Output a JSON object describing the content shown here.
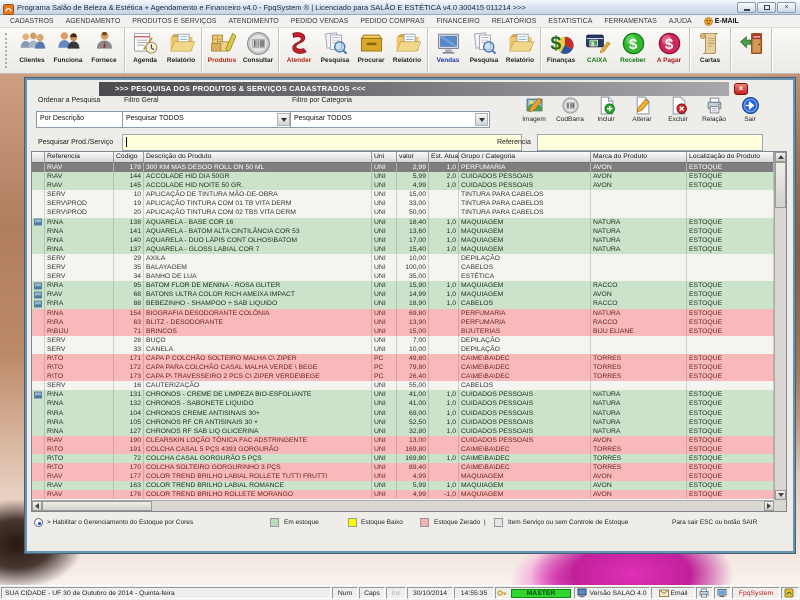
{
  "window": {
    "title": "Programa Salão de Beleza & Estética + Agendamento e Financeiro v4.0 - FpqSystem ® | Licenciado para  SALÃO E ESTÉTICA v4.0 300415 011214 >>>"
  },
  "menu": {
    "items": [
      {
        "label": "CADASTROS"
      },
      {
        "label": "AGENDAMENTO"
      },
      {
        "label": "PRODUTOS E SERVIÇOS"
      },
      {
        "label": "ATENDIMENTO"
      },
      {
        "label": "PEDIDO VENDAS"
      },
      {
        "label": "PEDIDO COMPRAS"
      },
      {
        "label": "FINANCEIRO"
      },
      {
        "label": "RELATÓRIOS"
      },
      {
        "label": "ESTATISTICA"
      },
      {
        "label": "FERRAMENTAS"
      },
      {
        "label": "AJUDA"
      },
      {
        "label": "E-MAIL",
        "icon": "email-menu-icon",
        "bold": true
      }
    ]
  },
  "toolbar": {
    "groups": [
      {
        "items": [
          {
            "label": "Clientes",
            "icon": "clients-icon"
          },
          {
            "label": "Funciona",
            "icon": "staff-icon"
          },
          {
            "label": "Fornece",
            "icon": "supplier-icon"
          }
        ]
      },
      {
        "items": [
          {
            "label": "Agenda",
            "icon": "agenda-icon"
          },
          {
            "label": "Relatório",
            "icon": "report-icon"
          }
        ]
      },
      {
        "items": [
          {
            "label": "Produtos",
            "icon": "products-icon",
            "color": "#b02810"
          },
          {
            "label": "Consultar",
            "icon": "barcode-icon"
          }
        ]
      },
      {
        "items": [
          {
            "label": "Atender",
            "icon": "attend-icon",
            "color": "#b02810"
          },
          {
            "label": "Pesquisa",
            "icon": "search-docs-icon"
          },
          {
            "label": "Procurar",
            "icon": "drawer-icon"
          },
          {
            "label": "Relatório",
            "icon": "report-icon"
          }
        ]
      },
      {
        "items": [
          {
            "label": "Vendas",
            "icon": "sales-icon",
            "color": "#1838a8"
          },
          {
            "label": "Pesquisa",
            "icon": "search-docs-icon"
          },
          {
            "label": "Relatório",
            "icon": "report-icon"
          }
        ]
      },
      {
        "items": [
          {
            "label": "Finanças",
            "icon": "finance-icon"
          },
          {
            "label": "CAIXA",
            "icon": "cash-icon",
            "color": "#187818"
          },
          {
            "label": "Receber",
            "icon": "receive-icon",
            "color": "#187818"
          },
          {
            "label": "A Pagar",
            "icon": "pay-icon",
            "color": "#a81818"
          }
        ]
      },
      {
        "items": [
          {
            "label": "Cartas",
            "icon": "letters-icon"
          }
        ]
      },
      {
        "items": [
          {
            "label": "",
            "icon": "exit-icon"
          }
        ]
      }
    ]
  },
  "panel": {
    "title": ">>>  PESQUISA DOS PRODUTOS & SERVIÇOS CADASTRADOS  <<<"
  },
  "filters": {
    "order": {
      "label": "Ordenar a Pesquisa",
      "value": "Por Descrição"
    },
    "general": {
      "label": "Filtro Geral",
      "value": "Pesquisar TODOS"
    },
    "category": {
      "label": "Filtro por Categoria",
      "value": "Pesquisar TODOS"
    },
    "search": {
      "label": "Pesquisar Prod./Serviço",
      "value": ""
    },
    "reference": {
      "label": "Referencia",
      "value": ""
    }
  },
  "actions": {
    "buttons": [
      {
        "label": "Imagem",
        "icon": "image-icon"
      },
      {
        "label": "CodBarra",
        "icon": "barcode-icon"
      },
      {
        "label": "Incluir",
        "icon": "add-icon"
      },
      {
        "label": "Alterar",
        "icon": "edit-icon"
      },
      {
        "label": "Excluir",
        "icon": "delete-icon"
      },
      {
        "label": "Relação",
        "icon": "print-icon"
      },
      {
        "label": "Sair",
        "icon": "exit-arrow-icon"
      }
    ]
  },
  "table": {
    "columns": [
      {
        "label": "Referencia"
      },
      {
        "label": "Código"
      },
      {
        "label": "Descrição do Produto"
      },
      {
        "label": "Uni"
      },
      {
        "label": "valor"
      },
      {
        "label": "Est. Atual"
      },
      {
        "label": "Grupo / Categoria"
      },
      {
        "label": "Marca do Produto"
      },
      {
        "label": "Localização do Produto"
      }
    ],
    "rows": [
      {
        "ref": "R\\AV",
        "code": "178",
        "desc": "300 KM MAS DESOD ROLL ON 50 ML",
        "uni": "UNI",
        "valor": "2,99",
        "est": "1,0",
        "grupo": "PERFUMARIA",
        "marca": "AVON",
        "local": "ESTOQUE",
        "state": "selected",
        "icon": false
      },
      {
        "ref": "R\\AV",
        "code": "144",
        "desc": "ACCOLADE HID DIA 50GR",
        "uni": "UNI",
        "valor": "5,99",
        "est": "2,0",
        "grupo": "CUIDADOS PESSOAIS",
        "marca": "AVON",
        "local": "ESTOQUE",
        "state": "green",
        "icon": false
      },
      {
        "ref": "R\\AV",
        "code": "145",
        "desc": "ACCOLADE HID NOITE 50 GR.",
        "uni": "UNI",
        "valor": "4,99",
        "est": "1,0",
        "grupo": "CUIDADOS PESSOAIS",
        "marca": "AVON",
        "local": "ESTOQUE",
        "state": "green",
        "icon": false
      },
      {
        "ref": "SERV",
        "code": "10",
        "desc": "APLICAÇÃO DE TINTURA  MÃO-DE-OBRA",
        "uni": "UNI",
        "valor": "15,00",
        "est": "",
        "grupo": "TINTURA PARA CABELOS",
        "marca": "",
        "local": "",
        "state": "white",
        "icon": false
      },
      {
        "ref": "SERV\\PROD",
        "code": "19",
        "desc": "APLICAÇÃO TINTURA COM 01 TB VITA DERM",
        "uni": "UNI",
        "valor": "33,00",
        "est": "",
        "grupo": "TINTURA PARA CABELOS",
        "marca": "",
        "local": "",
        "state": "white",
        "icon": false
      },
      {
        "ref": "SERV\\PROD",
        "code": "20",
        "desc": "APLICAÇÃO TINTURA COM 02 TBS VITA DERM",
        "uni": "UNI",
        "valor": "50,00",
        "est": "",
        "grupo": "TINTURA PARA CABELOS",
        "marca": "",
        "local": "",
        "state": "white",
        "icon": false
      },
      {
        "ref": "R\\NA",
        "code": "138",
        "desc": "AQUARELA - BASE COR 16",
        "uni": "UNI",
        "valor": "18,40",
        "est": "1,0",
        "grupo": "MAQUIAGEM",
        "marca": "NATURA",
        "local": "ESTOQUE",
        "state": "green",
        "icon": true
      },
      {
        "ref": "R\\NA",
        "code": "141",
        "desc": "AQUARELA - BATOM ALTA CINTILÂNCIA COR 53",
        "uni": "UNI",
        "valor": "13,60",
        "est": "1,0",
        "grupo": "MAQUIAGEM",
        "marca": "NATURA",
        "local": "ESTOQUE",
        "state": "green",
        "icon": false
      },
      {
        "ref": "R\\NA",
        "code": "140",
        "desc": "AQUARELA - DUO LÁPIS CONT OLHOS\\BATOM",
        "uni": "UNI",
        "valor": "17,00",
        "est": "1,0",
        "grupo": "MAQUIAGEM",
        "marca": "NATURA",
        "local": "ESTOQUE",
        "state": "green",
        "icon": false
      },
      {
        "ref": "R\\NA",
        "code": "137",
        "desc": "AQUARELA - GLOSS LABIAL COR 7",
        "uni": "UNI",
        "valor": "15,40",
        "est": "1,0",
        "grupo": "MAQUIAGEM",
        "marca": "NATURA",
        "local": "ESTOQUE",
        "state": "green",
        "icon": false
      },
      {
        "ref": "SERV",
        "code": "29",
        "desc": "AXILA",
        "uni": "UNI",
        "valor": "10,00",
        "est": "",
        "grupo": "DEPILAÇÃO",
        "marca": "",
        "local": "",
        "state": "white",
        "icon": false
      },
      {
        "ref": "SERV",
        "code": "35",
        "desc": "BALAYAGEM",
        "uni": "UNI",
        "valor": "100,00",
        "est": "",
        "grupo": "CABELOS",
        "marca": "",
        "local": "",
        "state": "white",
        "icon": false
      },
      {
        "ref": "SERV",
        "code": "34",
        "desc": "BANHO DE LUA",
        "uni": "UNI",
        "valor": "35,00",
        "est": "",
        "grupo": "ESTÉTICA",
        "marca": "",
        "local": "",
        "state": "white",
        "icon": false
      },
      {
        "ref": "R\\RA",
        "code": "95",
        "desc": "BATOM FLOR DE MENINA - ROSA GLITER",
        "uni": "UNI",
        "valor": "15,90",
        "est": "1,0",
        "grupo": "MAQUIAGEM",
        "marca": "RACCO",
        "local": "ESTOQUE",
        "state": "green",
        "icon": true
      },
      {
        "ref": "R\\AV",
        "code": "68",
        "desc": "BATONS ULTRA COLOR RICH AMEIXA IMPACT",
        "uni": "UNI",
        "valor": "14,99",
        "est": "1,0",
        "grupo": "MAQUIAGEM",
        "marca": "AVON",
        "local": "ESTOQUE",
        "state": "green",
        "icon": true
      },
      {
        "ref": "R\\RA",
        "code": "88",
        "desc": "BEBEZINHO - SHAMPOO + SAB LIQUIDO",
        "uni": "UNI",
        "valor": "18,90",
        "est": "1,0",
        "grupo": "CABELOS",
        "marca": "RACCO",
        "local": "ESTOQUE",
        "state": "green",
        "icon": true
      },
      {
        "ref": "R\\NA",
        "code": "154",
        "desc": "BIOGRAFIA DESODORANTE COLÔNIA",
        "uni": "UNI",
        "valor": "69,80",
        "est": "",
        "grupo": "PERFUMARIA",
        "marca": "NATURA",
        "local": "ESTOQUE",
        "state": "red",
        "icon": false
      },
      {
        "ref": "R\\RA",
        "code": "63",
        "desc": "BLITZ - DESODORANTE",
        "uni": "UNI",
        "valor": "13,90",
        "est": "",
        "grupo": "PERFUMARIA",
        "marca": "RACCO",
        "local": "ESTOQUE",
        "state": "red",
        "icon": false
      },
      {
        "ref": "R\\BIJU",
        "code": "71",
        "desc": "BRINCOS",
        "uni": "UNI",
        "valor": "15,00",
        "est": "",
        "grupo": "BIJUTERIAS",
        "marca": "BIJU ELIANE",
        "local": "ESTOQUE",
        "state": "red",
        "icon": false
      },
      {
        "ref": "SERV",
        "code": "28",
        "desc": "BUÇO",
        "uni": "UNI",
        "valor": "7,00",
        "est": "",
        "grupo": "DEPILAÇÃO",
        "marca": "",
        "local": "",
        "state": "white",
        "icon": false
      },
      {
        "ref": "SERV",
        "code": "33",
        "desc": "CANELA",
        "uni": "UNI",
        "valor": "10,00",
        "est": "",
        "grupo": "DEPILAÇÃO",
        "marca": "",
        "local": "",
        "state": "white",
        "icon": false
      },
      {
        "ref": "R\\TO",
        "code": "171",
        "desc": "CAPA P COLCHÃO SOLTEIRO MALHA C\\ ZIPER",
        "uni": "PC",
        "valor": "49,80",
        "est": "",
        "grupo": "CA\\ME\\BA\\DEC",
        "marca": "TORRES",
        "local": "ESTOQUE",
        "state": "red",
        "icon": false
      },
      {
        "ref": "R\\TO",
        "code": "172",
        "desc": "CAPA PARA COLCHÃO CASAL MALHA VERDE \\ BEGE",
        "uni": "PC",
        "valor": "79,80",
        "est": "",
        "grupo": "CA\\ME\\BA\\DEC",
        "marca": "TORRES",
        "local": "ESTOQUE",
        "state": "red",
        "icon": false
      },
      {
        "ref": "R\\TO",
        "code": "173",
        "desc": "CAPA P\\ TRAVESSEIRO 2 PCS C\\ ZIPER VERDE\\BEGE",
        "uni": "PC",
        "valor": "26,40",
        "est": "",
        "grupo": "CA\\ME\\BA\\DEC",
        "marca": "TORRES",
        "local": "ESTOQUE",
        "state": "red",
        "icon": false
      },
      {
        "ref": "SERV",
        "code": "16",
        "desc": "CAUTERIZAÇÃO",
        "uni": "UNI",
        "valor": "55,00",
        "est": "",
        "grupo": "CABELOS",
        "marca": "",
        "local": "",
        "state": "white",
        "icon": false
      },
      {
        "ref": "R\\NA",
        "code": "131",
        "desc": "CHRONOS - CREME DE LIMPEZA BIO-ESFOLIANTE",
        "uni": "UNI",
        "valor": "41,00",
        "est": "1,0",
        "grupo": "CUIDADOS PESSOAIS",
        "marca": "NATURA",
        "local": "ESTOQUE",
        "state": "green",
        "icon": true
      },
      {
        "ref": "R\\NA",
        "code": "132",
        "desc": "CHRONOS - SABONETE LIQUIDO",
        "uni": "UNI",
        "valor": "41,00",
        "est": "1,0",
        "grupo": "CUIDADOS PESSOAIS",
        "marca": "NATURA",
        "local": "ESTOQUE",
        "state": "green",
        "icon": false
      },
      {
        "ref": "R\\RA",
        "code": "104",
        "desc": "CHRONOS CREME ANTISINAIS 30+",
        "uni": "UNI",
        "valor": "69,00",
        "est": "1,0",
        "grupo": "CUIDADOS PESSOAIS",
        "marca": "NATURA",
        "local": "ESTOQUE",
        "state": "green",
        "icon": false
      },
      {
        "ref": "R\\RA",
        "code": "105",
        "desc": "CHRONOS RF CR ANTISINAIS 30 +",
        "uni": "UNI",
        "valor": "52,50",
        "est": "1,0",
        "grupo": "CUIDADOS PESSOAIS",
        "marca": "NATURA",
        "local": "ESTOQUE",
        "state": "green",
        "icon": false
      },
      {
        "ref": "R\\NA",
        "code": "127",
        "desc": "CHRONOS RF SAB LIQ GLICERINA",
        "uni": "UNI",
        "valor": "32,80",
        "est": "1,0",
        "grupo": "CUIDADOS PESSOAIS",
        "marca": "NATURA",
        "local": "ESTOQUE",
        "state": "green",
        "icon": false
      },
      {
        "ref": "R\\AV",
        "code": "190",
        "desc": "CLEARSKIN LOÇÃO TÔNICA FAC ADSTRINGENTE",
        "uni": "UNI",
        "valor": "13,00",
        "est": "",
        "grupo": "CUIDADOS PESSOAIS",
        "marca": "AVON",
        "local": "ESTOQUE",
        "state": "red",
        "icon": false
      },
      {
        "ref": "R\\TO",
        "code": "191",
        "desc": "COLCHA CASAL 5 PÇS 4393 GORGURÃO",
        "uni": "UNI",
        "valor": "169,80",
        "est": "",
        "grupo": "CA\\ME\\BA\\DEC",
        "marca": "TORRES",
        "local": "ESTOQUE",
        "state": "red",
        "icon": false
      },
      {
        "ref": "R\\TO",
        "code": "72",
        "desc": "COLCHA CASAL GORGURÃO 5 PÇS",
        "uni": "UNI",
        "valor": "169,80",
        "est": "1,0",
        "grupo": "CA\\ME\\BA\\DEC",
        "marca": "TORRES",
        "local": "ESTOQUE",
        "state": "green",
        "icon": false
      },
      {
        "ref": "R\\TO",
        "code": "170",
        "desc": "COLCHA SOLTEIRO GORGURINHO 3 PÇS",
        "uni": "UNI",
        "valor": "89,40",
        "est": "",
        "grupo": "CA\\ME\\BA\\DEC",
        "marca": "TORRES",
        "local": "ESTOQUE",
        "state": "red",
        "icon": false
      },
      {
        "ref": "R\\AV",
        "code": "177",
        "desc": "COLOR TREND BRILHO LABIAL ROLLETE TUTTI FRUTTI",
        "uni": "UNI",
        "valor": "4,99",
        "est": "",
        "grupo": "MAQUIAGEM",
        "marca": "AVON",
        "local": "ESTOQUE",
        "state": "red",
        "icon": false
      },
      {
        "ref": "R\\AV",
        "code": "163",
        "desc": "COLOR TREND BRILHO LABIAL ROMANCE",
        "uni": "UNI",
        "valor": "5,99",
        "est": "1,0",
        "grupo": "MAQUIAGEM",
        "marca": "AVON",
        "local": "ESTOQUE",
        "state": "green",
        "icon": false
      },
      {
        "ref": "R\\AV",
        "code": "176",
        "desc": "COLOR TREND BRILHO ROLLETE MORANGO",
        "uni": "UNI",
        "valor": "4,99",
        "est": "-1,0",
        "grupo": "MAQUIAGEM",
        "marca": "AVON",
        "local": "ESTOQUE",
        "state": "red",
        "icon": false
      }
    ]
  },
  "legend": {
    "toggle_label": "> Habilitar o Gerenciamento do Estoque por Cores",
    "items": [
      {
        "color": "#b9dcb9",
        "label": "Em estoque"
      },
      {
        "color": "#ffff00",
        "label": "Estoque Baixo"
      },
      {
        "color": "#f7b0b0",
        "label": "Estoque Zerado"
      },
      {
        "color": "#e6e6e6",
        "label": "Item Serviço ou sem Controle de Estoque"
      }
    ],
    "exit_hint": "Para sair ESC ou botão SAIR"
  },
  "statusbar": {
    "segments": [
      {
        "text": "SUA CIDADE - UF 30 de Outubro de 2014 - Quinta-feira"
      },
      {
        "text": "Num"
      },
      {
        "text": "Caps"
      },
      {
        "text": "Ins",
        "muted": true
      },
      {
        "text": "30/10/2014"
      },
      {
        "text": "14:55:35"
      },
      {
        "text": "MASTER",
        "icon": "key-icon",
        "style": "master"
      },
      {
        "text": "Versão SALAO 4.0",
        "icon": "pc-small-icon"
      },
      {
        "text": "Email",
        "icon": "mail-small-icon"
      },
      {
        "text": "",
        "icon": "printer-small-icon"
      },
      {
        "text": "",
        "icon": "monitor-small-icon"
      },
      {
        "text": "FpqSystem",
        "style": "brand"
      },
      {
        "text": "",
        "icon": "app-small-icon"
      }
    ]
  }
}
